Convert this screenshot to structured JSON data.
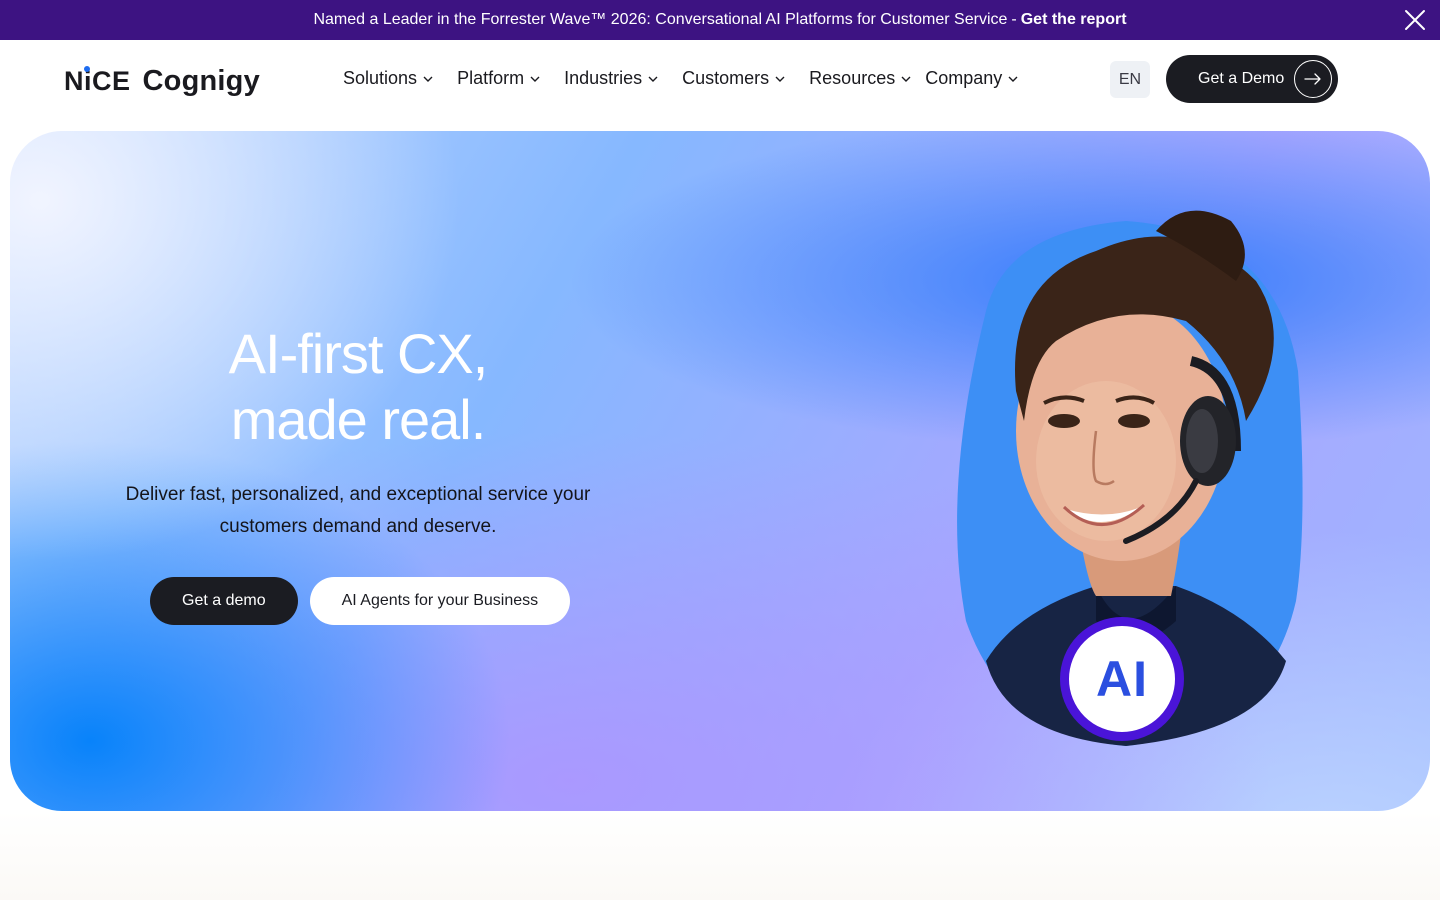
{
  "banner": {
    "text": "Named a Leader in the Forrester Wave™ 2026: Conversational AI Platforms for Customer Service",
    "separator": "-",
    "link": "Get the report",
    "close_icon": "close-icon"
  },
  "header": {
    "logo_nice": "NiCE",
    "logo_cognigy": "Cognigy",
    "nav": [
      {
        "label": "Solutions"
      },
      {
        "label": "Platform"
      },
      {
        "label": "Industries"
      },
      {
        "label": "Customers"
      },
      {
        "label": "Resources"
      },
      {
        "label": "Company"
      }
    ],
    "lang": "EN",
    "cta": "Get a Demo"
  },
  "hero": {
    "title_line1": "AI-first CX,",
    "title_line2": "made real.",
    "subtitle": "Deliver fast, personalized, and exceptional service your customers demand and deserve.",
    "primary_cta": "Get a demo",
    "secondary_cta": "AI Agents for your Business",
    "badge": "AI"
  },
  "colors": {
    "banner_bg": "#3d1382",
    "dark_button": "#1b1c22",
    "badge_ring": "#4a14d8",
    "badge_text": "#2b4fe0",
    "portrait_bg": "#3d8ff5"
  },
  "icons": [
    "close-icon",
    "chevron-down-icon",
    "arrow-right-icon"
  ]
}
